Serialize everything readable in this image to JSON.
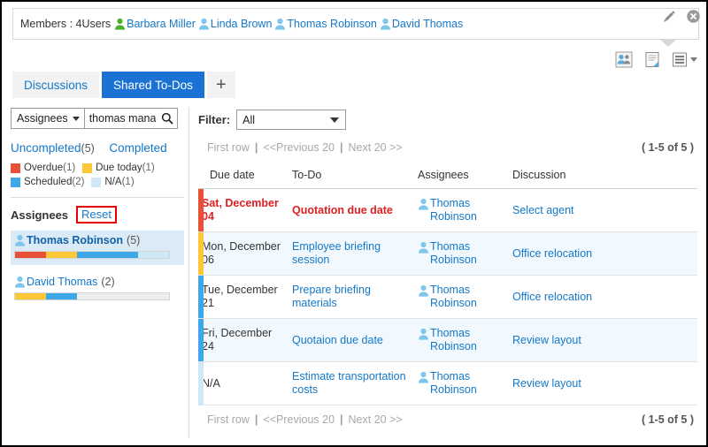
{
  "header": {
    "members_label": "Members : 4Users",
    "members": [
      {
        "name": "Barbara Miller",
        "icon": "user-icon-green",
        "color": "#4caf2a"
      },
      {
        "name": "Linda Brown",
        "icon": "user-icon",
        "color": "#7ec6ee"
      },
      {
        "name": "Thomas Robinson",
        "icon": "user-icon",
        "color": "#7ec6ee"
      },
      {
        "name": "David Thomas",
        "icon": "user-icon",
        "color": "#7ec6ee"
      }
    ],
    "edit_icon": "pencil-icon",
    "close_icon": "close-circle-icon",
    "tool_icons": [
      "add-members-icon",
      "memo-icon",
      "list-menu-icon"
    ]
  },
  "tabs": [
    {
      "label": "Discussions",
      "active": false
    },
    {
      "label": "Shared To-Dos",
      "active": true
    }
  ],
  "tab_add_label": "+",
  "sidebar": {
    "search": {
      "select_label": "Assignees",
      "value": "thomas manager",
      "placeholder": "",
      "search_icon": "search-icon"
    },
    "status_links": [
      {
        "label": "Uncompleted",
        "count": "(5)"
      },
      {
        "label": "Completed",
        "count": ""
      }
    ],
    "legend": [
      {
        "label": "Overdue",
        "count": "(1)",
        "color": "#e8503a"
      },
      {
        "label": "Due today",
        "count": "(1)",
        "color": "#fcc835"
      },
      {
        "label": "Scheduled",
        "count": "(2)",
        "color": "#3da8e8"
      },
      {
        "label": "N/A",
        "count": "(1)",
        "color": "#cfe8f7"
      }
    ],
    "assignees_title": "Assignees",
    "reset_label": "Reset",
    "assignees": [
      {
        "name": "Thomas Robinson",
        "count": "(5)",
        "selected": true,
        "segments": [
          {
            "color": "#e8503a",
            "pct": 20
          },
          {
            "color": "#fcc835",
            "pct": 20
          },
          {
            "color": "#3da8e8",
            "pct": 40
          },
          {
            "color": "#cfe8f7",
            "pct": 20
          }
        ]
      },
      {
        "name": "David Thomas",
        "count": "(2)",
        "selected": false,
        "segments": [
          {
            "color": "#fcc835",
            "pct": 20
          },
          {
            "color": "#3da8e8",
            "pct": 20
          }
        ]
      }
    ]
  },
  "main": {
    "filter_label": "Filter:",
    "filter_value": "All",
    "pager": {
      "first_row": "First row",
      "previous": "<<Previous 20",
      "next": "Next 20 >>",
      "count": "( 1-5 of 5 )"
    },
    "columns": {
      "due_date": "Due date",
      "todo": "To-Do",
      "assignees": "Assignees",
      "discussion": "Discussion"
    },
    "rows": [
      {
        "status_color": "#e8503a",
        "overdue": true,
        "alt": false,
        "due_date": "Sat, December 04",
        "todo": "Quotation due date",
        "assignee": "Thomas Robinson",
        "discussion": "Select agent"
      },
      {
        "status_color": "#fcc835",
        "overdue": false,
        "alt": true,
        "due_date": "Mon, December 06",
        "todo": "Employee briefing session",
        "assignee": "Thomas Robinson",
        "discussion": "Office relocation"
      },
      {
        "status_color": "#3da8e8",
        "overdue": false,
        "alt": false,
        "due_date": "Tue, December 21",
        "todo": "Prepare briefing materials",
        "assignee": "Thomas Robinson",
        "discussion": "Office relocation"
      },
      {
        "status_color": "#3da8e8",
        "overdue": false,
        "alt": true,
        "due_date": "Fri, December 24",
        "todo": "Quotaion due date",
        "assignee": "Thomas Robinson",
        "discussion": "Review layout"
      },
      {
        "status_color": "#cfe8f7",
        "overdue": false,
        "alt": false,
        "due_date": "N/A",
        "todo": "Estimate transportation costs",
        "assignee": "Thomas Robinson",
        "discussion": "Review layout"
      }
    ]
  },
  "colors": {
    "accent": "#1478c8",
    "tab_active": "#1a73d4",
    "overdue": "#e02020",
    "row_alt": "#f2f9fe"
  }
}
